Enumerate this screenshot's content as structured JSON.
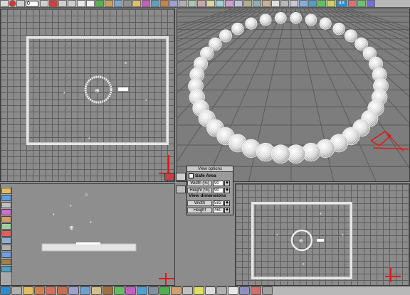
{
  "top_toolbar": {
    "frame_field": "0",
    "zoom_label": "4X"
  },
  "view_options": {
    "title": "View options",
    "safe_area_label": "Safe Area",
    "width_pct_label": "Width (%)",
    "width_pct_value": "90",
    "height_pct_label": "Height (%)",
    "height_pct_value": "90",
    "dimensions_header": "View dimensions",
    "width_label": "Width",
    "width_value": "583",
    "height_label": "Height",
    "height_value": "460"
  },
  "colors": {
    "grid": "#5e5e5e",
    "safe_frame": "#e6e6e6",
    "axis": "#e01818",
    "viewport_bg": "#8b8b8b"
  }
}
